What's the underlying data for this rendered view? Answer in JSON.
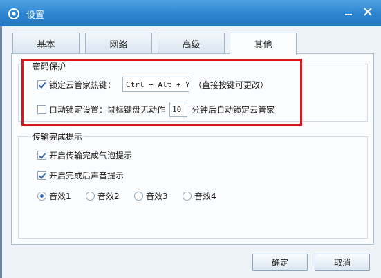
{
  "window": {
    "title": "设置"
  },
  "tabs": [
    {
      "label": "基本",
      "active": false
    },
    {
      "label": "网络",
      "active": false
    },
    {
      "label": "高级",
      "active": false
    },
    {
      "label": "其他",
      "active": true
    }
  ],
  "password_group": {
    "title": "密码保护",
    "hotkey": {
      "label": "锁定云管家热键：",
      "checked": true,
      "value": "Ctrl + Alt + Y",
      "hint": "（直接按键可更改）"
    },
    "autolock": {
      "label": "自动锁定设置：鼠标键盘无动作",
      "checked": false,
      "minutes": "10",
      "suffix": "分钟后自动锁定云管家"
    }
  },
  "transfer_group": {
    "title": "传输完成提示",
    "bubble": {
      "label": "开启传输完成气泡提示",
      "checked": true
    },
    "sound": {
      "label": "开启完成后声音提示",
      "checked": true
    },
    "effects": [
      {
        "label": "音效1",
        "selected": true
      },
      {
        "label": "音效2",
        "selected": false
      },
      {
        "label": "音效3",
        "selected": false
      },
      {
        "label": "音效4",
        "selected": false
      }
    ]
  },
  "buttons": {
    "ok": "确定",
    "cancel": "取消"
  },
  "colors": {
    "titlebar": "#2d84cf",
    "highlight": "#d9161d"
  }
}
